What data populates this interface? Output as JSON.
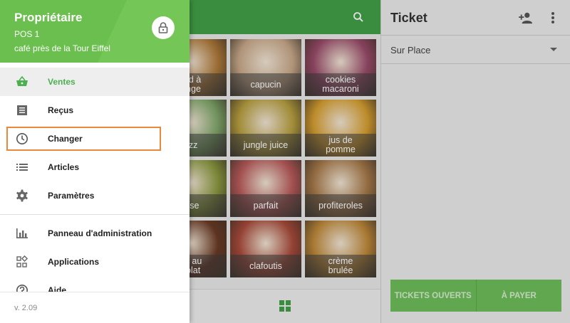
{
  "drawer": {
    "owner": "Propriétaire",
    "pos": "POS 1",
    "store": "café près de la Tour Eiffel",
    "items": [
      {
        "label": "Ventes",
        "icon": "basket-icon",
        "active": true
      },
      {
        "label": "Reçus",
        "icon": "receipt-icon"
      },
      {
        "label": "Changer",
        "icon": "clock-icon"
      },
      {
        "label": "Articles",
        "icon": "list-icon"
      },
      {
        "label": "Paramètres",
        "icon": "gear-icon"
      }
    ],
    "items2": [
      {
        "label": "Panneau d'administration",
        "icon": "bar-chart-icon"
      },
      {
        "label": "Applications",
        "icon": "apps-icon"
      },
      {
        "label": "Aide",
        "icon": "help-icon"
      }
    ],
    "version": "v. 2.09"
  },
  "products": [
    {
      "name": "ard à\nange",
      "color": "#b07a3a"
    },
    {
      "name": "capucin",
      "color": "#c9a98a"
    },
    {
      "name": "cookies\nmacaroni",
      "color": "#9a4b6a"
    },
    {
      "name": "fizz",
      "color": "#7fa66a"
    },
    {
      "name": "jungle juice",
      "color": "#b8a040"
    },
    {
      "name": "jus de\npomme",
      "color": "#d8a030"
    },
    {
      "name": "oise",
      "color": "#8c9a40"
    },
    {
      "name": "parfait",
      "color": "#b85a5a"
    },
    {
      "name": "profiteroles",
      "color": "#a87a4a"
    },
    {
      "name": "es au\ncolat",
      "color": "#6b3a25"
    },
    {
      "name": "clafoutis",
      "color": "#a84a3a"
    },
    {
      "name": "crème\nbrulée",
      "color": "#c08a3a"
    }
  ],
  "ticket": {
    "title": "Ticket",
    "dining": "Sur Place",
    "btn_open": "Tickets ouverts",
    "btn_pay": "À payer"
  },
  "colors": {
    "brand": "#43a047",
    "highlight": "#e8893c"
  }
}
